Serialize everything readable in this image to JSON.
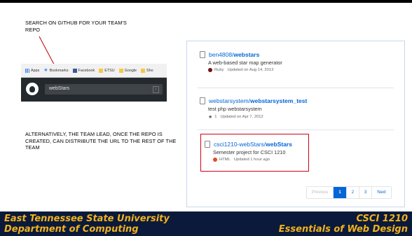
{
  "notes": {
    "note1": "SEARCH ON GITHUB FOR YOUR TEAM'S REPO",
    "note2": "ALTERNATIVELY, THE TEAM LEAD, ONCE THE REPO IS CREATED, CAN DISTRIBUTE THE URL TO THE REST OF THE TEAM"
  },
  "browser": {
    "bookmarks": [
      "Apps",
      "Bookmarks",
      "Facebook",
      "ETSU",
      "Google",
      "Sho"
    ],
    "search_value": "webStars",
    "search_hint": "/"
  },
  "results": [
    {
      "owner": "ben4808/",
      "repo": "webstars",
      "description": "A web-based star map generator",
      "language": "Ruby",
      "language_color": "#701516",
      "updated": "Updated on Aug 14, 2013"
    },
    {
      "owner": "webstarsystem/",
      "repo": "webstarsystem_test",
      "description": "test php webstarsystem",
      "stars": "1",
      "updated": "Updated on Apr 7, 2012"
    },
    {
      "owner": "csci1210-webStars/",
      "repo": "webStars",
      "description": "Semester project for CSCI 1210",
      "language": "HTML",
      "language_color": "#e34c26",
      "updated": "Updated 1 hour ago"
    }
  ],
  "pagination": {
    "previous": "Previous",
    "pages": [
      "1",
      "2",
      "3"
    ],
    "next": "Next",
    "current": "1"
  },
  "footer": {
    "left1": "East Tennessee State University",
    "left2": "Department of Computing",
    "right1": "CSCI 1210",
    "right2": "Essentials of Web Design"
  },
  "colors": {
    "footer_bg": "#0b1a3a",
    "footer_text": "#f2b21c",
    "link": "#0366d6",
    "highlight": "#d0021b"
  }
}
